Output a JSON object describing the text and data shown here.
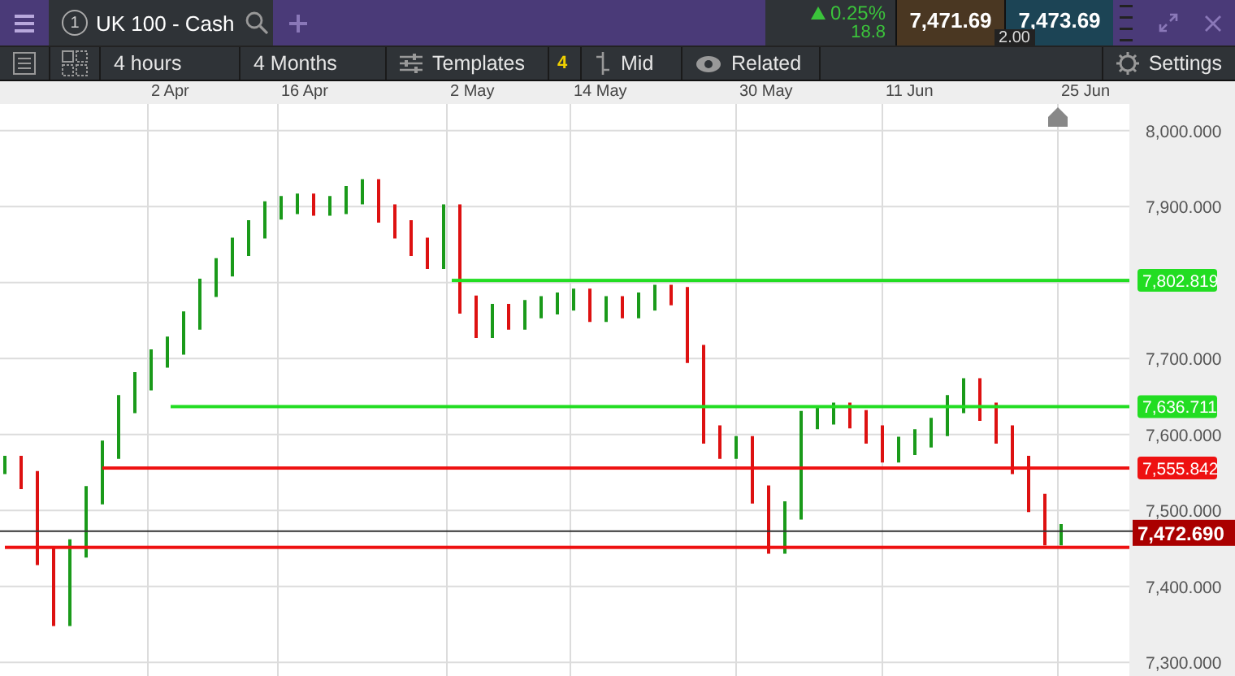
{
  "tab": {
    "number": "1",
    "title": "UK 100 - Cash"
  },
  "quote": {
    "change": "0.25%",
    "change_points": "18.8",
    "sell": "7,471.69",
    "buy": "7,473.69",
    "spread": "2.00"
  },
  "toolbar": {
    "interval": "4 hours",
    "range": "4 Months",
    "templates": "Templates",
    "templates_count": "4",
    "price_type": "Mid",
    "related": "Related",
    "settings": "Settings"
  },
  "date_axis": [
    "2 Apr",
    "16 Apr",
    "2 May",
    "14 May",
    "30 May",
    "11 Jun",
    "25 Jun"
  ],
  "price_axis": [
    "8,000.000",
    "7,900.000",
    "7,700.000",
    "7,600.000",
    "7,500.000",
    "7,400.000",
    "7,300.000"
  ],
  "levels": [
    {
      "color": "#22dd22",
      "label": "7,802.819"
    },
    {
      "color": "#22dd22",
      "label": "7,636.711"
    },
    {
      "color": "#ee1111",
      "label": "7,555.842"
    },
    {
      "color": "#ee1111"
    }
  ],
  "current_price": {
    "label": "7,472.690"
  }
}
